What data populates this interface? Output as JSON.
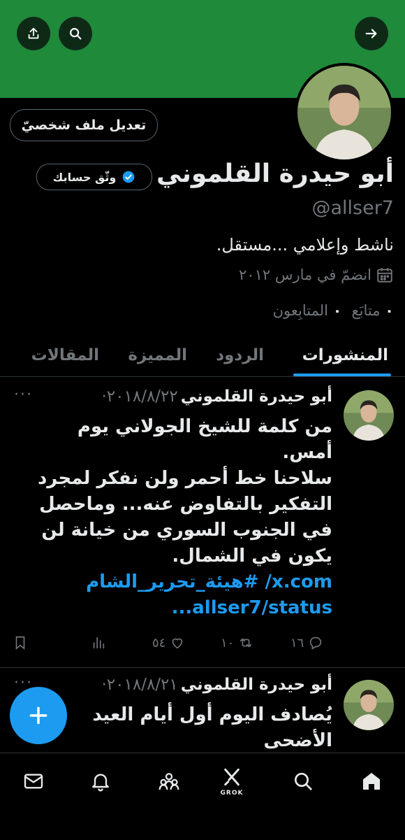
{
  "colors": {
    "banner": "#1f8a3a",
    "accent": "#1d9bf0",
    "muted": "#71767b",
    "border": "#2f3336"
  },
  "header": {
    "share_icon": "share-icon",
    "search_icon": "search-icon",
    "forward_icon": "arrow-right-icon"
  },
  "profile": {
    "edit_label": "تعديل ملف شخصيّ",
    "verify_label": "وثّق حسابك",
    "name": "أبو حيدرة القلموني",
    "handle": "@allser7",
    "bio": "ناشط وإعلامي ...مستقل.",
    "joined": "انضمّ في مارس ٢٠١٢",
    "following_count": "٠",
    "following_label": "متابَع",
    "followers_count": "٠",
    "followers_label": "المتابِعون"
  },
  "tabs": [
    "المنشورات",
    "الردود",
    "المميزة",
    "المقالات"
  ],
  "posts": [
    {
      "author": "أبو حيدرة القلموني",
      "date": "٢٠١٨/٨/٢٢·",
      "more": "···",
      "lines": [
        "من كلمة للشيخ الجولاني يوم",
        "أمس.",
        "سلاحنا خط أحمر ولن نفكر لمجرد",
        "التفكير بالتفاوض عنه... وماحصل",
        "في الجنوب السوري من خيانة لن",
        "يكون في الشمال."
      ],
      "link1": "x.com/ #هيئة_تحرير_الشام",
      "link2": "allser7/status...",
      "replies": "١٦",
      "reposts": "١٠",
      "likes": "٥٤"
    },
    {
      "author": "أبو حيدرة القلموني",
      "date": "٢٠١٨/٨/٢١·",
      "more": "···",
      "lines": [
        "يُصادف اليوم أول أيام العيد",
        "الأضحى"
      ]
    }
  ],
  "fab_icon": "plus-icon",
  "nav": {
    "home": "home-icon",
    "search": "search-icon",
    "grok_label": "GROK",
    "communities": "communities-icon",
    "notifications": "bell-icon",
    "messages": "mail-icon"
  }
}
